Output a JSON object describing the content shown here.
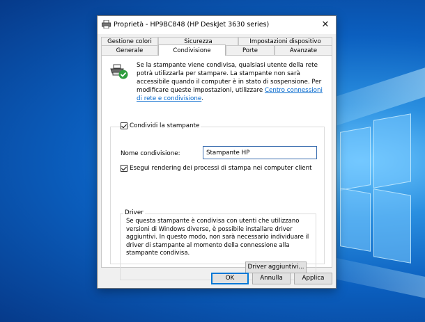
{
  "window": {
    "title": "Proprietà - HP9BC848 (HP DeskJet 3630 series)",
    "close_glyph": "✕"
  },
  "tabs": {
    "row1": [
      "Gestione colori",
      "Sicurezza",
      "Impostazioni dispositivo"
    ],
    "row2": [
      "Generale",
      "Condivisione",
      "Porte",
      "Avanzate"
    ],
    "active": "Condivisione"
  },
  "info": {
    "text": "Se la stampante viene condivisa, qualsiasi utente della rete potrà utilizzarla per stampare. La stampante non sarà accessibile quando il computer è in stato di sospensione. Per modificare queste impostazioni, utilizzare ",
    "link": "Centro connessioni di rete e condivisione",
    "text_end": ".",
    "icon": "shared-printer-icon"
  },
  "share": {
    "checkbox_label": "Condividi la stampante",
    "checked": true,
    "name_label": "Nome condivisione:",
    "name_value": "Stampante HP",
    "render_label": "Esegui rendering dei processi di stampa nei computer client",
    "render_checked": true
  },
  "driver": {
    "legend": "Driver",
    "text": "Se questa stampante è condivisa con utenti che utilizzano versioni di Windows diverse, è possibile installare driver aggiuntivi. In questo modo, non sarà necessario individuare il driver di stampante al momento della connessione alla stampante condivisa.",
    "button": "Driver aggiuntivi..."
  },
  "buttons": {
    "ok": "OK",
    "cancel": "Annulla",
    "apply": "Applica"
  },
  "colors": {
    "accent": "#0078d7",
    "link": "#0066cc",
    "desktop": "#0b5fbf"
  }
}
